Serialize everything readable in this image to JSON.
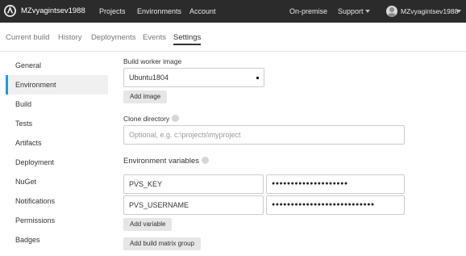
{
  "header": {
    "brand": "MZvyagintsev1988",
    "nav": {
      "projects": "Projects",
      "environments": "Environments",
      "account": "Account",
      "on_premise": "On-premise",
      "support": "Support"
    },
    "user": "MZvyagintsev1988"
  },
  "tabs": {
    "current_build": "Current build",
    "history": "History",
    "deployments": "Deployments",
    "events": "Events",
    "settings": "Settings"
  },
  "sidebar": {
    "items": [
      {
        "label": "General"
      },
      {
        "label": "Environment",
        "active": true
      },
      {
        "label": "Build"
      },
      {
        "label": "Tests"
      },
      {
        "label": "Artifacts"
      },
      {
        "label": "Deployment"
      },
      {
        "label": "NuGet"
      },
      {
        "label": "Notifications"
      },
      {
        "label": "Permissions"
      },
      {
        "label": "Badges"
      }
    ]
  },
  "form": {
    "worker_image": {
      "label": "Build worker image",
      "value": "Ubuntu1804",
      "add_button": "Add image"
    },
    "clone_directory": {
      "label": "Clone directory",
      "placeholder": "Optional, e.g. c:\\projects\\myproject"
    },
    "env_vars": {
      "title": "Environment variables",
      "rows": [
        {
          "name": "PVS_KEY",
          "value": "●●●●●●●●●●●●●●●●●●●●"
        },
        {
          "name": "PVS_USERNAME",
          "value": "●●●●●●●●●●●●●●●●●●●●●●●●●●●"
        }
      ],
      "add_button": "Add variable"
    },
    "add_matrix_button": "Add build matrix group"
  },
  "colors": {
    "topbar": "#2b2b2b",
    "accent": "#1e9bd7",
    "active_bg": "#f0f0f0"
  }
}
